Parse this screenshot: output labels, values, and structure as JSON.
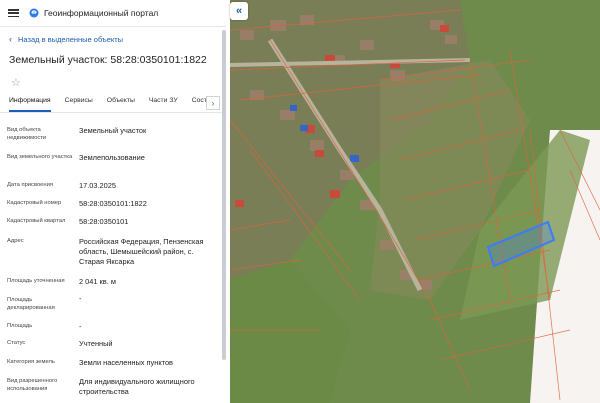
{
  "header": {
    "app_title": "Геоинформационный портал"
  },
  "nav": {
    "back_label": "Назад в выделенные объекты"
  },
  "object": {
    "title": "Земельный участок: 58:28:0350101:1822"
  },
  "tabs": [
    {
      "label": "Информация"
    },
    {
      "label": "Сервисы"
    },
    {
      "label": "Объекты"
    },
    {
      "label": "Части ЗУ"
    },
    {
      "label": "Соста"
    }
  ],
  "tab_scroll_icon": "chevron-right-icon",
  "properties": [
    {
      "label": "Вид объекта недвижимости",
      "value": "Земельный участок"
    },
    {
      "label": "Вид земельного участка",
      "value": "Землепользование"
    },
    {
      "label": "Дата присвоения",
      "value": "17.03.2025"
    },
    {
      "label": "Кадастровый номер",
      "value": "58:28:0350101:1822"
    },
    {
      "label": "Кадастровый квартал",
      "value": "58:28:0350101"
    },
    {
      "label": "Адрес",
      "value": "Российская Федерация, Пензенская область, Шемышейский район, с. Старая Яксарка"
    },
    {
      "label": "Площадь уточненная",
      "value": "2 041 кв. м"
    },
    {
      "label": "Площадь декларированная",
      "value": "-"
    },
    {
      "label": "Площадь",
      "value": "-"
    },
    {
      "label": "Статус",
      "value": "Учтенный"
    },
    {
      "label": "Категория земель",
      "value": "Земли населенных пунктов"
    },
    {
      "label": "Вид разрешенного использования",
      "value": "Для индивидуального жилищного строительства"
    }
  ],
  "map": {
    "highlight_color": "#3a7bff",
    "parcel_line_color": "#e0623c"
  }
}
